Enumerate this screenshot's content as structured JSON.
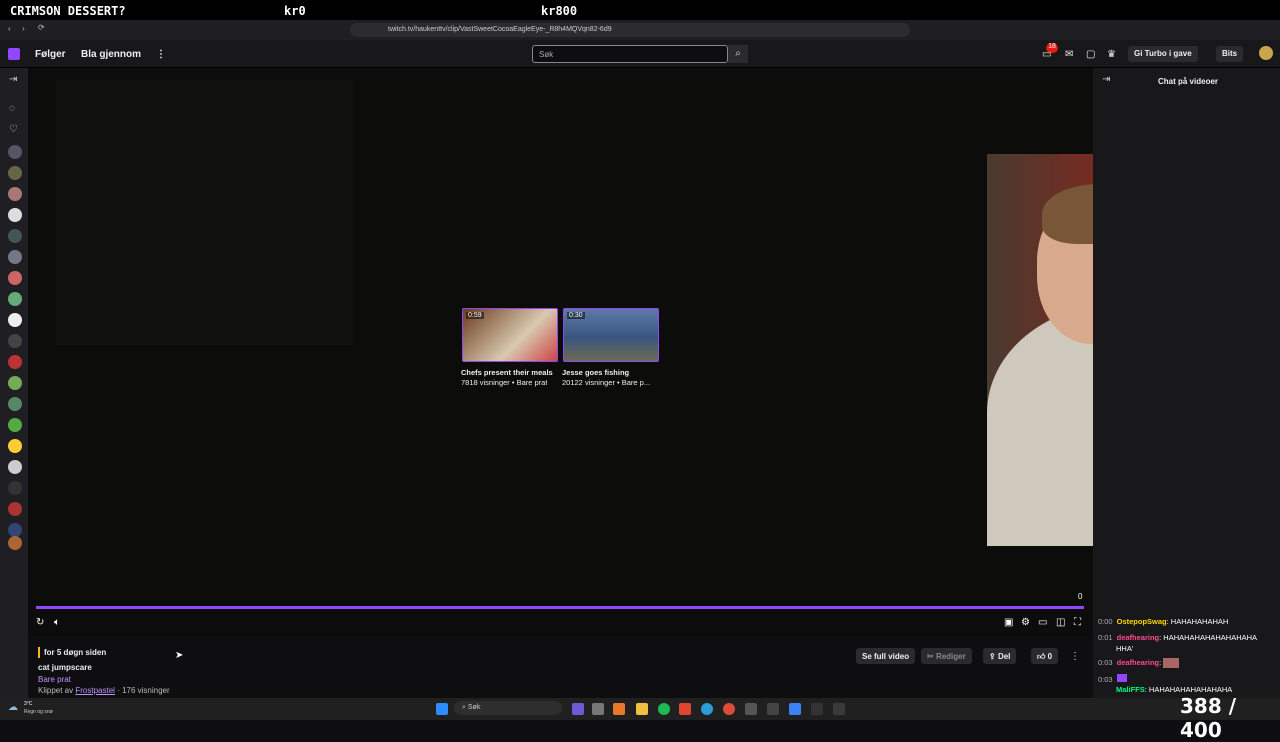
{
  "overlay": {
    "title": "CRIMSON DESSERT?",
    "left_money": "kr0",
    "right_money": "kr800"
  },
  "browser": {
    "url": "twitch.tv/haukenttv/clip/VastSweetCocoaEagleEye-_R8h4MQVqn82-6d9"
  },
  "nav": {
    "following": "Følger",
    "browse": "Bla gjennom",
    "search_placeholder": "Søk",
    "notifications_badge": "18",
    "turbo_label": "Gi Turbo i gave",
    "bits_label": "Bits"
  },
  "player": {
    "clips": [
      {
        "duration": "0:59",
        "title": "Chefs present their meals",
        "meta": "7818 visninger • Bare prat"
      },
      {
        "duration": "0:30",
        "title": "Jesse goes fishing",
        "meta": "20122 visninger • Bare p..."
      }
    ],
    "count_label": "0"
  },
  "clip_info": {
    "time_ago": "for 5 døgn siden",
    "clip_title": "cat jumpscare",
    "category": "Bare prat",
    "clipped_by_prefix": "Klippet av",
    "clipper": "Frostpastel",
    "views": " · 176 visninger"
  },
  "actions": {
    "full_video": "Se full video",
    "edit": "Rediger",
    "share": "Del",
    "likes": "0"
  },
  "chat": {
    "header": "Chat på videoer",
    "messages": [
      {
        "time": "0:00",
        "user": "OstepopSwag",
        "user_color": "#ffd700",
        "text": ": HAHAHAHAHAH"
      },
      {
        "time": "0:01",
        "user": "deafhearing",
        "user_color": "#ff4a8d",
        "text": ": HAHAHAHAHAHAHAHAHA"
      },
      {
        "time": "",
        "user": "",
        "user_color": "#ffffff",
        "text": "HHA'"
      },
      {
        "time": "0:03",
        "user": "deafhearing",
        "user_color": "#ff4a8d",
        "text": ":"
      },
      {
        "time": "0:03",
        "user": "",
        "user_color": "#ffffff",
        "text": ""
      },
      {
        "time": "",
        "user": "MaliFFS",
        "user_color": "#00ff7f",
        "text": ": HAHAHAHAHAHAHAHA"
      }
    ]
  },
  "taskbar": {
    "weather_temp": "3°C",
    "weather_desc": "Regn og snø",
    "search": "Søk"
  },
  "counter": "388 / 400",
  "colors": {
    "accent": "#9147ff",
    "background": "#0e0e10"
  }
}
